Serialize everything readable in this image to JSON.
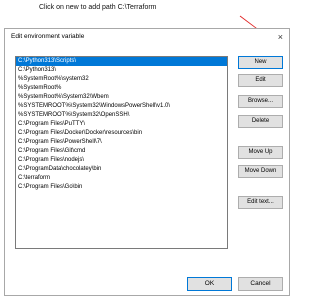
{
  "annotation": {
    "text": "Click on new to add path C:\\Terraform"
  },
  "dialog": {
    "title": "Edit environment variable",
    "close_glyph": "×"
  },
  "list": {
    "selected_index": 0,
    "items": [
      "C:\\Python313\\Scripts\\",
      "C:\\Python313\\",
      "%SystemRoot%\\system32",
      "%SystemRoot%",
      "%SystemRoot%\\System32\\Wbem",
      "%SYSTEMROOT%\\System32\\WindowsPowerShell\\v1.0\\",
      "%SYSTEMROOT%\\System32\\OpenSSH\\",
      "C:\\Program Files\\PuTTY\\",
      "C:\\Program Files\\Docker\\Docker\\resources\\bin",
      "C:\\Program Files\\PowerShell\\7\\",
      "C:\\Program Files\\Git\\cmd",
      "C:\\Program Files\\nodejs\\",
      "C:\\ProgramData\\chocolatey\\bin",
      "C:\\terraform",
      "C:\\Program Files\\Go\\bin"
    ]
  },
  "buttons": {
    "new": "New",
    "edit": "Edit",
    "browse": "Browse...",
    "delete": "Delete",
    "move_up": "Move Up",
    "move_down": "Move Down",
    "edit_text": "Edit text...",
    "ok": "OK",
    "cancel": "Cancel"
  },
  "colors": {
    "selection": "#0078d7",
    "arrow": "#e02020"
  }
}
